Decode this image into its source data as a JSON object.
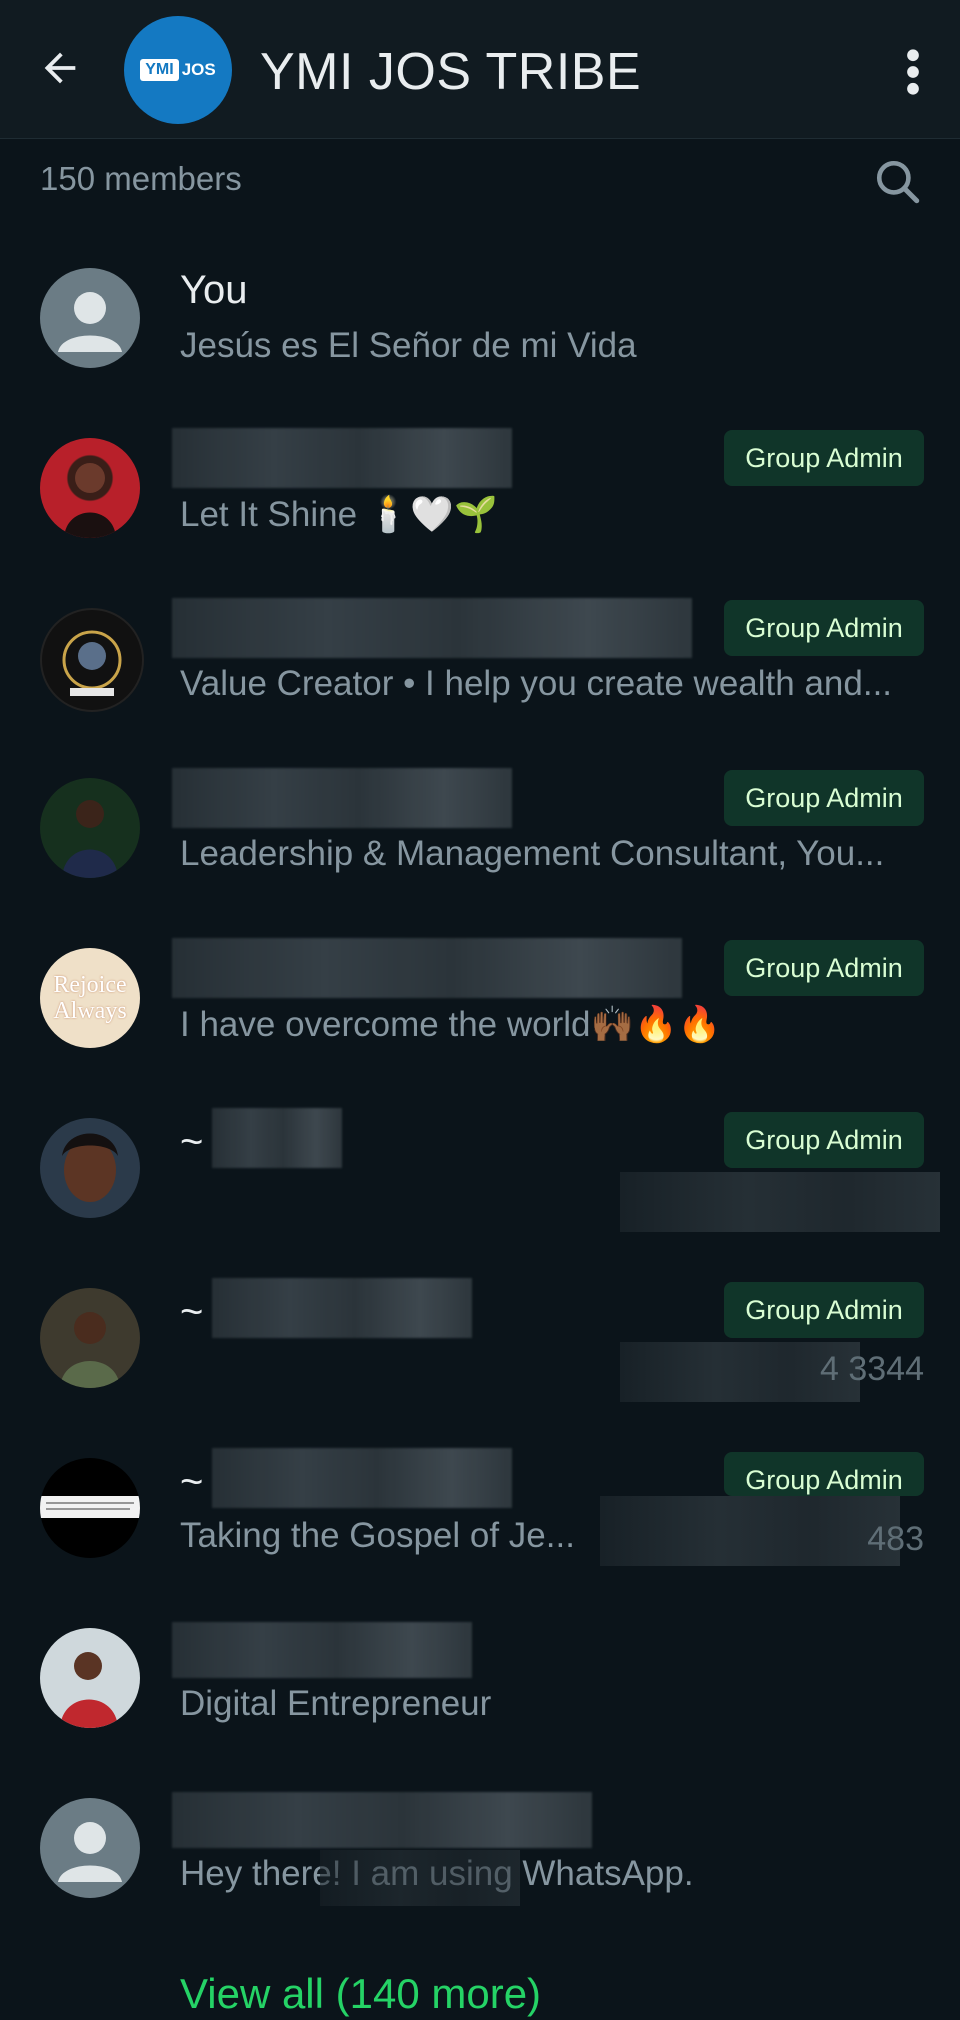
{
  "header": {
    "title": "YMI JOS TRIBE",
    "logo_text_left": "YMI",
    "logo_text_right": "JOS"
  },
  "members": {
    "count_label": "150 members"
  },
  "rows": [
    {
      "name": "You",
      "status": "Jesús es El Señor de mi Vida",
      "badge": "",
      "phone": "",
      "prefix": ""
    },
    {
      "name": "",
      "status": "Let It Shine 🕯️🤍🌱",
      "badge": "Group Admin",
      "phone": "",
      "prefix": ""
    },
    {
      "name": "",
      "status": "Value Creator • I help you create wealth and...",
      "badge": "Group Admin",
      "phone": "",
      "prefix": ""
    },
    {
      "name": "",
      "status": "Leadership & Management Consultant, You...",
      "badge": "Group Admin",
      "phone": "",
      "prefix": ""
    },
    {
      "name": "",
      "status": "I have overcome the world🙌🏾🔥🔥",
      "badge": "Group Admin",
      "phone": "",
      "prefix": ""
    },
    {
      "name": "",
      "status": "",
      "badge": "Group Admin",
      "phone": "",
      "prefix": "~"
    },
    {
      "name": "",
      "status": "",
      "badge": "Group Admin",
      "phone": "4 3344",
      "prefix": "~"
    },
    {
      "name": "",
      "status": "Taking the Gospel of Je...",
      "badge": "Group Admin",
      "phone": "483",
      "prefix": "~"
    },
    {
      "name": "",
      "status": "Digital Entrepreneur",
      "badge": "",
      "phone": "",
      "prefix": ""
    },
    {
      "name": "",
      "status": "Hey there! I am using WhatsApp.",
      "badge": "",
      "phone": "",
      "prefix": ""
    }
  ],
  "footer": {
    "view_all": "View all (140 more)"
  },
  "avatars": {
    "rejoice_text_1": "Rejoice",
    "rejoice_text_2": "Always"
  },
  "colors": {
    "background": "#0b141a",
    "header": "#111b21",
    "accent_green": "#25d366",
    "badge_bg": "#103529",
    "badge_text": "#d9fdd3"
  }
}
